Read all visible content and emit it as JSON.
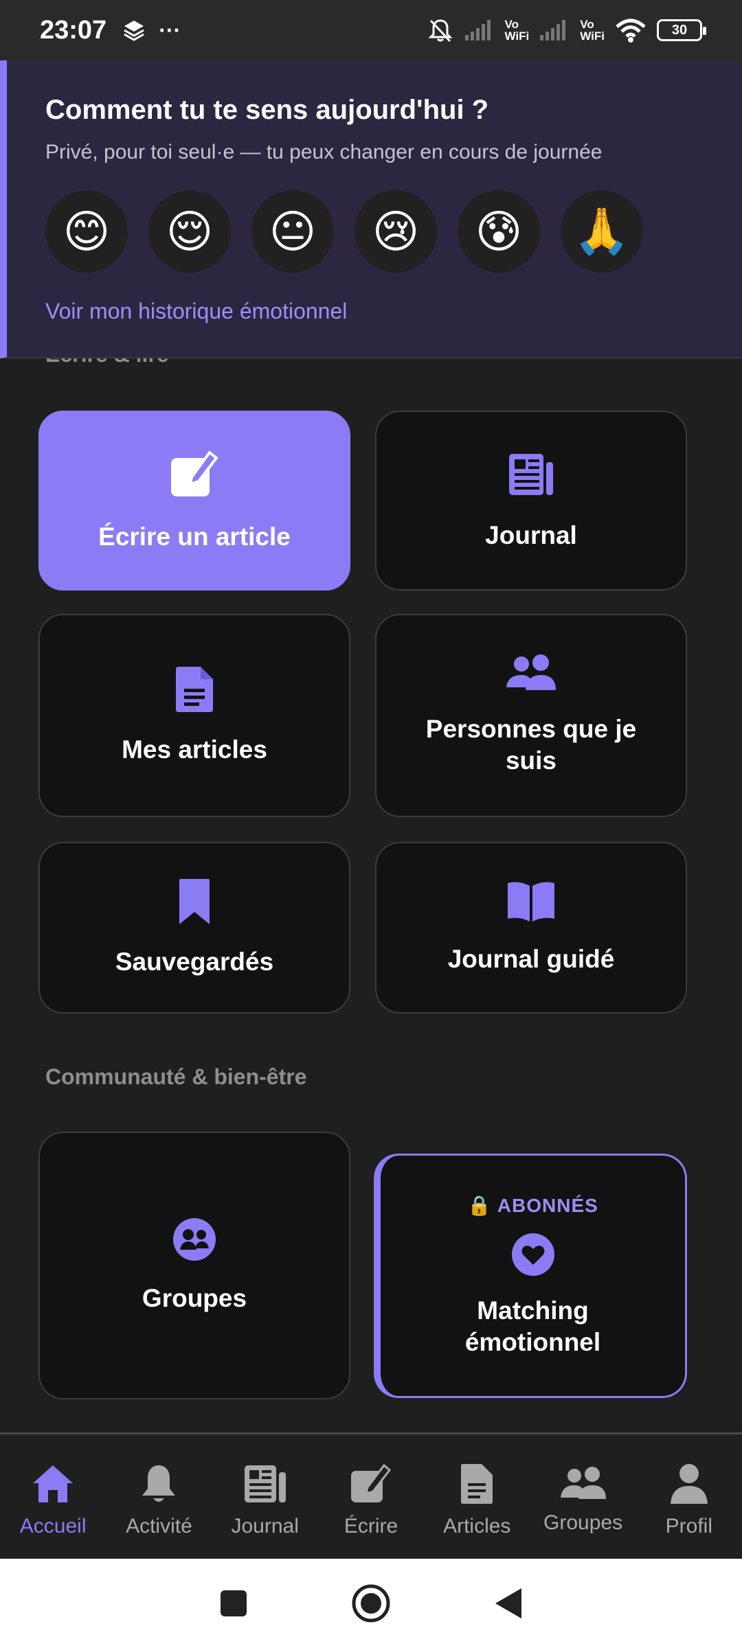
{
  "status_bar": {
    "time": "23:07",
    "more": "···",
    "vowifi_1": "Vo\nWiFi",
    "vowifi_2": "Vo\nWiFi",
    "battery": "30"
  },
  "mood": {
    "title": "Comment tu te sens aujourd'hui ?",
    "subtitle": "Privé, pour toi seul·e — tu peux changer en cours de journée",
    "emojis": [
      "😊",
      "😌",
      "😐",
      "😢",
      "😰",
      "🙏"
    ],
    "history_link": "Voir mon historique émotionnel"
  },
  "sections": {
    "write_read_heading": "Écrire & lire",
    "community_heading": "Communauté & bien-être"
  },
  "cards": {
    "write_article": "Écrire un article",
    "journal": "Journal",
    "my_articles": "Mes articles",
    "following": "Personnes que je suis",
    "saved": "Sauvegardés",
    "guided_journal": "Journal guidé",
    "groups": "Groupes",
    "premium_badge": "🔒 ABONNÉS",
    "matching": "Matching émotionnel"
  },
  "bottom_nav": {
    "items": [
      {
        "label": "Accueil",
        "icon": "home-icon",
        "active": true
      },
      {
        "label": "Activité",
        "icon": "bell-icon",
        "active": false
      },
      {
        "label": "Journal",
        "icon": "newspaper-icon",
        "active": false
      },
      {
        "label": "Écrire",
        "icon": "edit-icon",
        "active": false
      },
      {
        "label": "Articles",
        "icon": "document-icon",
        "active": false
      },
      {
        "label": "Groupes",
        "icon": "users-icon",
        "active": false
      },
      {
        "label": "Profil",
        "icon": "user-icon",
        "active": false
      }
    ]
  },
  "colors": {
    "accent": "#8b7cf6",
    "banner_bg": "#2d2640",
    "card_bg": "#121212"
  }
}
